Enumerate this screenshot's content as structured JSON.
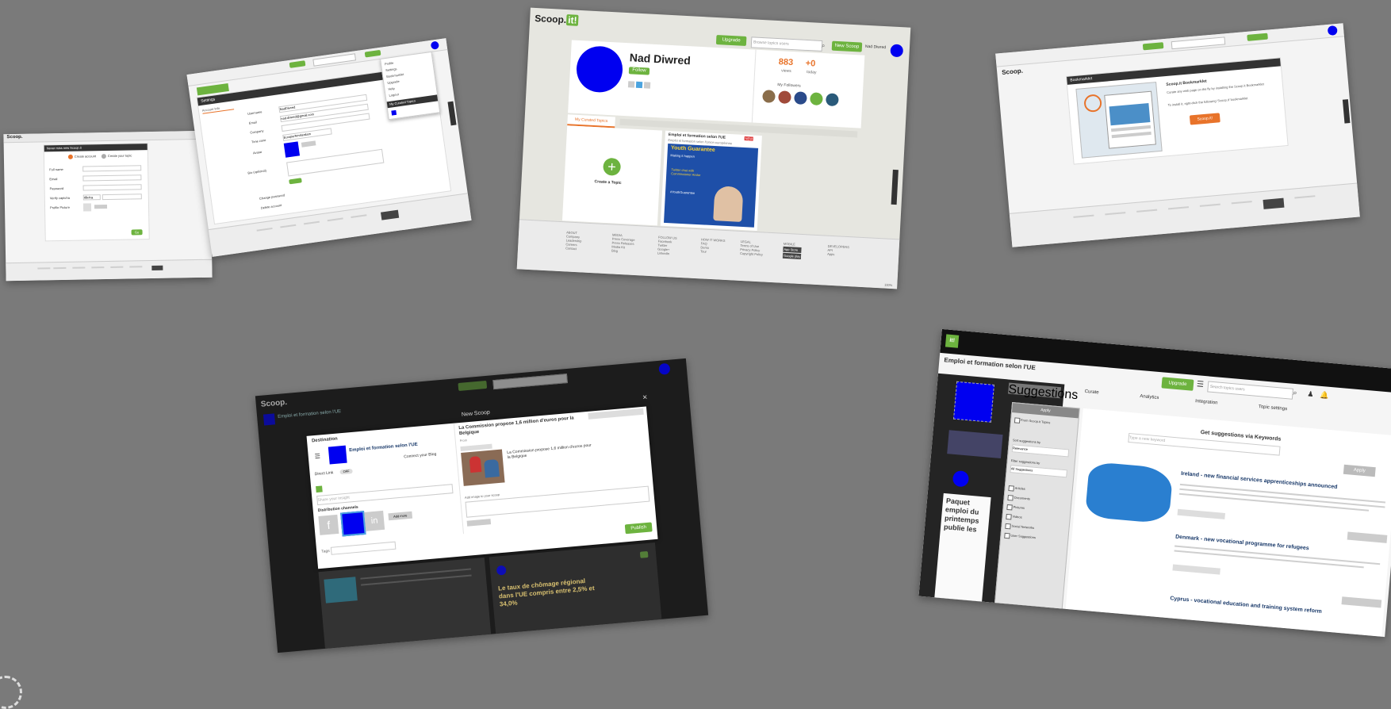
{
  "app": {
    "logo_text": "Scoop.",
    "logo_mark": "it!"
  },
  "card1": {
    "header": "Never miss new Scoop.it",
    "steps": [
      "Create account",
      "Create your topic"
    ],
    "fields": [
      "Full name",
      "Email",
      "Password",
      "Verify captcha",
      "Profile Picture"
    ],
    "captcha": "r8k4ra",
    "go": "Go"
  },
  "card2": {
    "header": "Settings",
    "tab": "Account Info",
    "labels": [
      "Username",
      "Email",
      "Company",
      "Time zone",
      "Avatar",
      "Bio (optional)",
      "Change password",
      "Delete account"
    ],
    "values": [
      "NadDiwred",
      "nad.diwred@gmail.com",
      "",
      "Europe/Amsterdam"
    ],
    "menu": [
      "Profile",
      "Settings",
      "Bookmarklet",
      "Upgrade",
      "Help",
      "Logout"
    ],
    "menu_header": "My Curated Topics"
  },
  "card3": {
    "upgrade": "Upgrade",
    "search_placeholder": "Browse topics users",
    "new_scoop": "New Scoop",
    "user_menu": "Nad Diwred",
    "name": "Nad Diwred",
    "follow": "Follow",
    "views_value": "883",
    "views_label": "views",
    "today_value": "+0",
    "today_label": "today",
    "followers_title": "My Followers",
    "tab_active": "My Curated Topics",
    "create_topic": "Create a Topic",
    "topic_title": "Emploi et formation selon l'UE",
    "topic_badge": "NEW",
    "topic_subtitle": "Emploi et formation selon l'Union européenne",
    "poster_line1": "Youth Guarantee",
    "poster_line2": "Making it happen",
    "poster_line3": "Twitter chat with Commissioner Andor",
    "poster_line4": "#YouthGuarantee",
    "footer": {
      "about": [
        "ABOUT",
        "Company",
        "Leadership",
        "Careers",
        "Contact"
      ],
      "media": [
        "MEDIA",
        "Press Coverage",
        "Press Releases",
        "Media Kit",
        "Blog"
      ],
      "follow": [
        "FOLLOW US",
        "Facebook",
        "Twitter",
        "Google+",
        "LinkedIn"
      ],
      "how": [
        "HOW IT WORKS",
        "FAQ",
        "Demo",
        "Tour"
      ],
      "legal": [
        "LEGAL",
        "Terms of Use",
        "Privacy Policy",
        "Copyright Policy"
      ],
      "mobile": [
        "MOBILE",
        "App Store",
        "Google play"
      ],
      "developers": [
        "DEVELOPERS",
        "API",
        "Apps"
      ]
    },
    "zoom": "100%"
  },
  "card4": {
    "header": "Bookmarklet",
    "title": "Scoop.it Bookmarklet",
    "text1": "Curate any web page on the fly by installing the Scoop.it Bookmarklet",
    "text2": "To install it, right-click the following 'Scoop.it' bookmarklet",
    "button": "Scoop.it!"
  },
  "card5": {
    "logo": "Scoop.",
    "topic_header": "Emploi et formation selon l'UE",
    "modal_title": "New Scoop",
    "destination": "Destination",
    "topic_name": "Emploi et formation selon l'UE",
    "connect_blog": "Connect your Blog",
    "direct_link": "Direct Link",
    "direct_off": "OFF",
    "insight_placeholder": "Share your insight",
    "distribution": "Distribution channels",
    "add_more": "Add more",
    "tags": "Tags",
    "article_title": "La Commission propose 1,6 million d'euros pour la Belgique",
    "from": "From",
    "caption": "La Commission propose 1,6 million d'euros pour la Belgique",
    "add_image": "Add image to your scoop",
    "publish": "Publish",
    "bg_title": "Le taux de chômage régional dans l'UE compris entre 2,5% et 34,0%"
  },
  "card6": {
    "logo": "it!",
    "topic": "Emploi et formation selon l'UE",
    "upgrade": "Upgrade",
    "search_placeholder": "Search topics users",
    "tabs": [
      "Curate",
      "Analytics",
      "Integration",
      "Topic settings"
    ],
    "suggestion_button": "Suggestions",
    "filter_header": "Apply",
    "filter_from": "From Scoop.it Topics",
    "sort_label": "Sort suggestions by",
    "sort_value": "Relevance",
    "filter_label": "Filter suggestions by",
    "filter_value": "All Suggestions",
    "checks": [
      "Articles",
      "Documents",
      "Pictures",
      "Videos",
      "Social Networks",
      "User Suggestions"
    ],
    "keyword_title": "Get suggestions via Keywords",
    "keyword_placeholder": "Type a new keyword",
    "apply": "Apply",
    "bg_headline": "Paquet emploi du printemps publie les",
    "item1_title": "Ireland - new financial services apprenticeships announced",
    "item2_title": "Denmark - new vocational programme for refugees",
    "item3_title": "Cyprus - vocational education and training system reform"
  }
}
